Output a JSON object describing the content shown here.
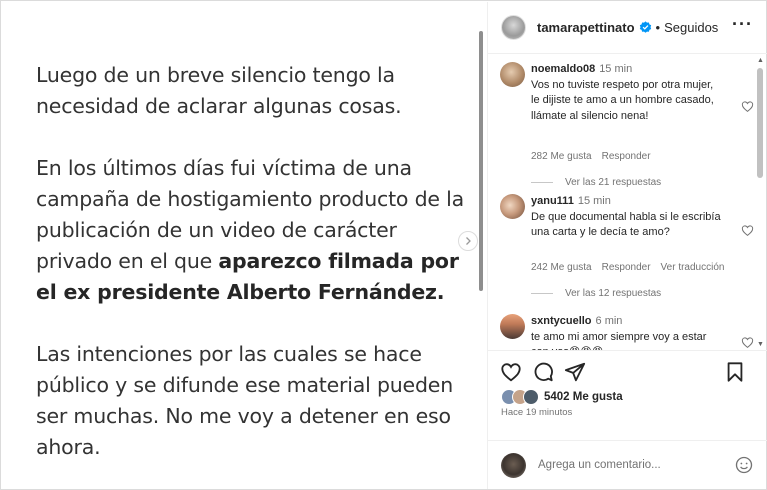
{
  "post": {
    "paragraph1": "Luego de un breve silencio tengo la necesidad de aclarar algunas cosas.",
    "paragraph2_start": "En los últimos días fui víctima de una campaña de hostigamiento producto de la publicación de un video de carácter privado en el que ",
    "paragraph2_bold": "aparezco filmada por el ex presidente Alberto Fernández.",
    "paragraph3": "Las intenciones por las cuales se hace público y se difunde ese material pueden ser muchas. No me voy a detener en eso ahora.",
    "next_icon": "chevron-right-icon"
  },
  "header": {
    "username": "tamarapettinato",
    "separator": "•",
    "follow_status": "Seguidos",
    "more_icon": "more-horizontal-icon",
    "verified_icon": "verified-badge-icon"
  },
  "comments": [
    {
      "user": "noemaldo08",
      "time": "15 min",
      "text": "Vos no tuviste respeto por otra mujer, le dijiste te amo a un hombre casado, llámate al silencio nena!",
      "likes": "282 Me gusta",
      "reply": "Responder",
      "translate": "",
      "replies": "Ver las 21 respuestas"
    },
    {
      "user": "yanu111",
      "time": "15 min",
      "text": "De que documental habla si le escribía una carta y le decía te amo?",
      "likes": "242 Me gusta",
      "reply": "Responder",
      "translate": "Ver traducción",
      "replies": "Ver las 12 respuestas"
    },
    {
      "user": "sxntycuello",
      "time": "6 min",
      "text": "te amo mi amor siempre voy a estar con vos😡😡😡",
      "likes": "",
      "reply": "",
      "translate": "",
      "replies": ""
    }
  ],
  "actions": {
    "like_icon": "heart-icon",
    "comment_icon": "comment-icon",
    "share_icon": "send-icon",
    "save_icon": "bookmark-icon",
    "likes_count": "5402 Me gusta",
    "time_ago": "Hace 19 minutos"
  },
  "add_comment": {
    "placeholder": "Agrega un comentario...",
    "emoji_icon": "emoji-icon"
  },
  "colors": {
    "verified": "#0095f6",
    "text": "#262626",
    "muted": "#737373",
    "border": "#dbdbdb"
  }
}
